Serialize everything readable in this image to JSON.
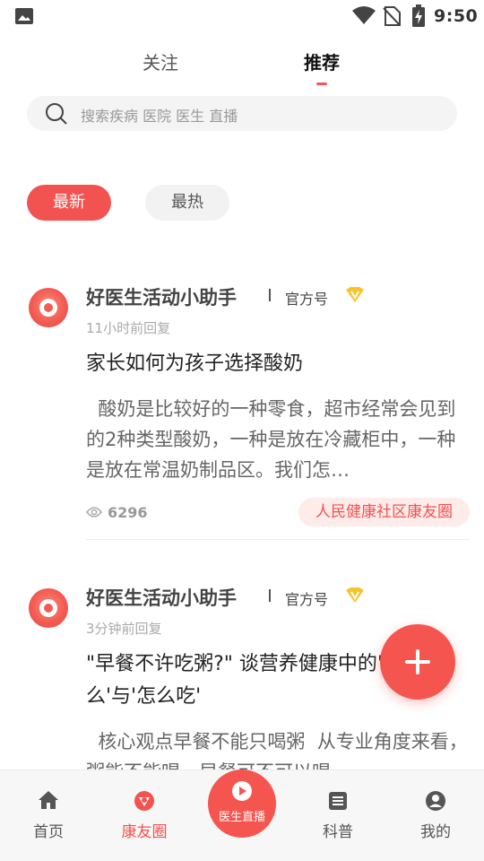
{
  "status_bar": {
    "time": "9:50",
    "icons": [
      "image-icon",
      "wifi-icon",
      "no-sim-icon",
      "battery-charging-icon"
    ]
  },
  "tabs": [
    {
      "label": "关注",
      "active": false
    },
    {
      "label": "推荐",
      "active": true
    }
  ],
  "search": {
    "placeholder": "搜索疾病 医院 医生 直播",
    "icon": "search-icon"
  },
  "filters": [
    {
      "label": "最新",
      "active": true
    },
    {
      "label": "最热",
      "active": false
    }
  ],
  "posts": [
    {
      "author": "好医生活动小助手",
      "badge": "官方号",
      "reply_time": "11小时前回复",
      "title": "家长如何为孩子选择酸奶",
      "excerpt": "  酸奶是比较好的一种零食，超市经常会见到的2种类型酸奶，一种是放在冷藏柜中，一种是放在常温奶制品区。我们怎…",
      "views": "6296",
      "community": "人民健康社区康友圈"
    },
    {
      "author": "好医生活动小助手",
      "badge": "官方号",
      "reply_time": "3分钟前回复",
      "title": "\"早餐不许吃粥?\" 谈营养健康中的'吃什么'与'怎么吃'",
      "excerpt": "  核心观点早餐不能只喝粥  从专业角度来看，粥能不能喝，早餐可不可以喝"
    }
  ],
  "bottom_nav": [
    {
      "label": "首页",
      "icon": "home-icon",
      "active": false
    },
    {
      "label": "康友圈",
      "icon": "circle-icon",
      "active": true
    },
    {
      "label": "医生直播",
      "icon": "play-icon",
      "active": false
    },
    {
      "label": "科普",
      "icon": "article-icon",
      "active": false
    },
    {
      "label": "我的",
      "icon": "profile-icon",
      "active": false
    }
  ],
  "colors": {
    "accent": "#f25350",
    "accent_light": "#fdecea",
    "text_primary": "#222222",
    "text_secondary": "#999999"
  }
}
